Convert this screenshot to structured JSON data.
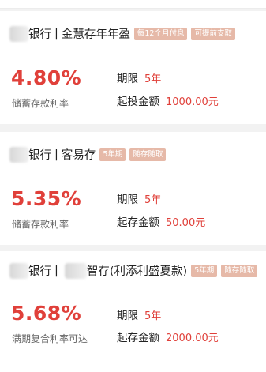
{
  "products": [
    {
      "bank_suffix": "银行",
      "separator": "|",
      "product_name": "金慧存年年盈",
      "tags": [
        "每12个月付息",
        "可提前支取"
      ],
      "rate": "4.80%",
      "rate_label": "储蓄存款利率",
      "term_label": "期限",
      "term_value": "5年",
      "amount_label": "起投金额",
      "amount_value": "1000.00元"
    },
    {
      "bank_suffix": "银行",
      "separator": "|",
      "product_name": "客易存",
      "tags": [
        "5年期",
        "随存随取"
      ],
      "rate": "5.35%",
      "rate_label": "储蓄存款利率",
      "term_label": "期限",
      "term_value": "5年",
      "amount_label": "起存金额",
      "amount_value": "50.00元"
    },
    {
      "bank_suffix": "银行",
      "separator": "|",
      "product_name": "智存(利添利盛夏款)",
      "tags": [
        "5年期",
        "随存随取"
      ],
      "rate": "5.68%",
      "rate_label": "满期复合利率可达",
      "term_label": "期限",
      "term_value": "5年",
      "amount_label": "起存金额",
      "amount_value": "2000.00元"
    }
  ],
  "colors": {
    "accent": "#e0403a",
    "tag_bg": "#e6b9a8",
    "page_bg": "#f2f2f2"
  }
}
